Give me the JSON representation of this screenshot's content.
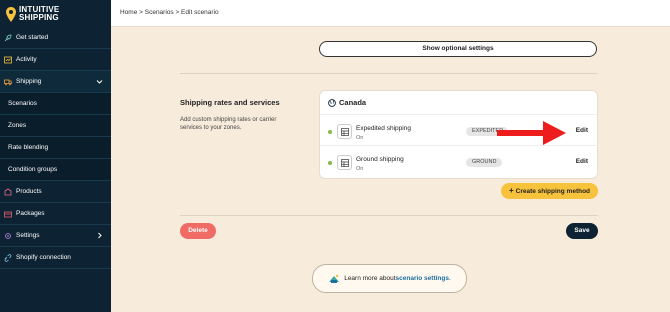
{
  "app": {
    "logo_line1": "INTUITIVE",
    "logo_line2": "SHIPPING",
    "brand_color": "#f7c23c"
  },
  "sidebar": {
    "items": [
      {
        "label": "Get started",
        "icon": "rocket-icon"
      },
      {
        "label": "Activity",
        "icon": "activity-icon"
      },
      {
        "label": "Shipping",
        "icon": "truck-icon",
        "expanded": true
      },
      {
        "label": "Scenarios"
      },
      {
        "label": "Zones"
      },
      {
        "label": "Rate blending"
      },
      {
        "label": "Condition groups"
      },
      {
        "label": "Products",
        "icon": "products-icon"
      },
      {
        "label": "Packages",
        "icon": "package-icon"
      },
      {
        "label": "Settings",
        "icon": "gear-icon"
      },
      {
        "label": "Shopify connection",
        "icon": "link-icon"
      }
    ]
  },
  "breadcrumb": "Home > Scenarios > Edit scenario",
  "optional_settings_label": "Show optional settings",
  "section": {
    "title": "Shipping rates and services",
    "description": "Add custom shipping rates or carrier services to your zones."
  },
  "zone": {
    "name": "Canada",
    "rates": [
      {
        "name": "Expedited shipping",
        "status": "On",
        "code": "EXPEDITED",
        "edit_label": "Edit"
      },
      {
        "name": "Ground shipping",
        "status": "On",
        "code": "GROUND",
        "edit_label": "Edit"
      }
    ]
  },
  "create_shipping_label": "Create shipping method",
  "delete_label": "Delete",
  "save_label": "Save",
  "learn": {
    "prefix": "Learn more about ",
    "link": "scenario settings",
    "suffix": "."
  }
}
